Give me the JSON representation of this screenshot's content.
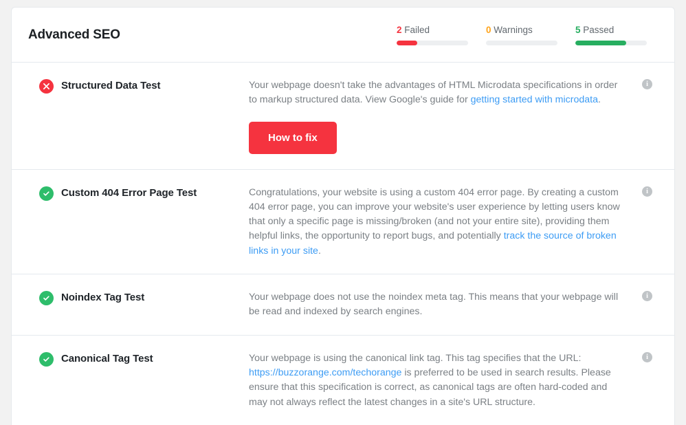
{
  "header": {
    "title": "Advanced SEO",
    "stats": [
      {
        "name": "failed",
        "count": "2",
        "label": "Failed",
        "percent": 29,
        "color": "#f5333f"
      },
      {
        "name": "warnings",
        "count": "0",
        "label": "Warnings",
        "percent": 0,
        "color": "#ffa41b"
      },
      {
        "name": "passed",
        "count": "5",
        "label": "Passed",
        "percent": 71,
        "color": "#27ae60"
      }
    ]
  },
  "info_icon_glyph": "i",
  "tests": [
    {
      "status": "fail",
      "status_icon": "x-icon",
      "name": "Structured Data Test",
      "desc_parts": [
        {
          "type": "text",
          "value": "Your webpage doesn't take the advantages of HTML Microdata specifications in order to markup structured data. View Google's guide for "
        },
        {
          "type": "link",
          "value": "getting started with microdata"
        },
        {
          "type": "text",
          "value": "."
        }
      ],
      "button": "How to fix"
    },
    {
      "status": "pass",
      "status_icon": "check-icon",
      "name": "Custom 404 Error Page Test",
      "desc_parts": [
        {
          "type": "text",
          "value": "Congratulations, your website is using a custom 404 error page. By creating a custom 404 error page, you can improve your website's user experience by letting users know that only a specific page is missing/broken (and not your entire site), providing them helpful links, the opportunity to report bugs, and potentially "
        },
        {
          "type": "link",
          "value": "track the source of broken links in your site"
        },
        {
          "type": "text",
          "value": "."
        }
      ],
      "button": null
    },
    {
      "status": "pass",
      "status_icon": "check-icon",
      "name": "Noindex Tag Test",
      "desc_parts": [
        {
          "type": "text",
          "value": "Your webpage does not use the noindex meta tag. This means that your webpage will be read and indexed by search engines."
        }
      ],
      "button": null
    },
    {
      "status": "pass",
      "status_icon": "check-icon",
      "name": "Canonical Tag Test",
      "desc_parts": [
        {
          "type": "text",
          "value": "Your webpage is using the canonical link tag. This tag specifies that the URL: "
        },
        {
          "type": "link",
          "value": "https://buzzorange.com/techorange"
        },
        {
          "type": "text",
          "value": " is preferred to be used in search results. Please ensure that this specification is correct, as canonical tags are often hard-coded and may not always reflect the latest changes in a site's URL structure."
        }
      ],
      "button": null
    }
  ]
}
